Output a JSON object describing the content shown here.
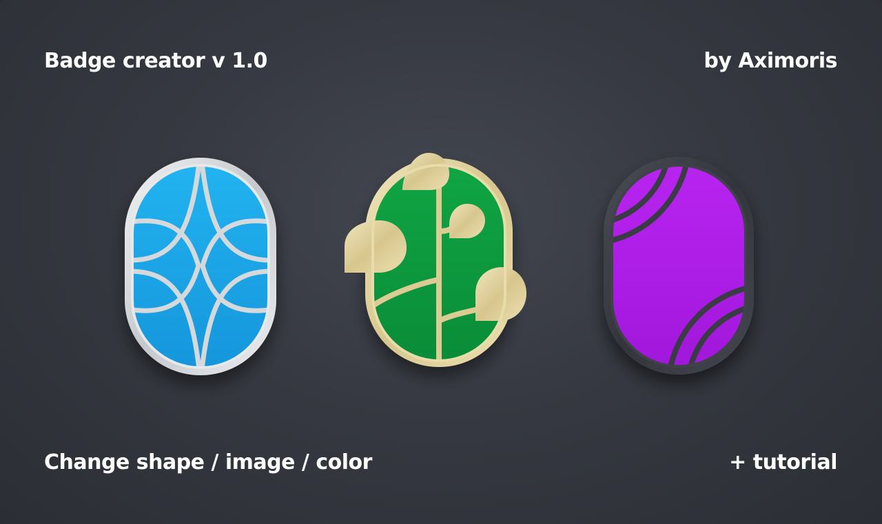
{
  "header": {
    "title": "Badge creator v 1.0",
    "author": "by Aximoris"
  },
  "footer": {
    "features": "Change shape / image / color",
    "extra": "+ tutorial"
  },
  "badges": [
    {
      "name": "blue-arcs-badge",
      "fill": "#1aa7e8",
      "rim": "#d7dadd",
      "rim_style": "silver"
    },
    {
      "name": "green-plant-badge",
      "fill": "#0e9a3f",
      "rim": "#e3d6a6",
      "rim_style": "gold"
    },
    {
      "name": "purple-rings-badge",
      "fill": "#b21ee8",
      "rim": "#3b3d44",
      "rim_style": "dark"
    }
  ],
  "colors": {
    "background": "#383b43",
    "text": "#ffffff"
  }
}
